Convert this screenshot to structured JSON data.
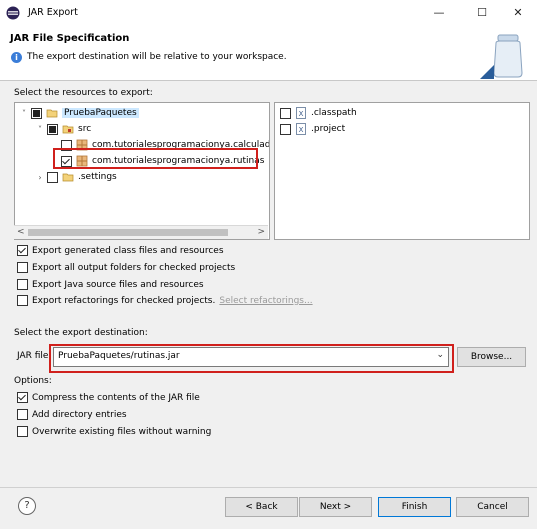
{
  "window": {
    "title": "JAR Export",
    "minimize": "—",
    "maximize": "☐",
    "close": "✕"
  },
  "header": {
    "title": "JAR File Specification",
    "message": "The export destination will be relative to your workspace."
  },
  "resources_label": "Select the resources to export:",
  "tree": {
    "project": "PruebaPaquetes",
    "src": "src",
    "pkg1": "com.tutorialesprogramacionya.calculadora",
    "pkg2": "com.tutorialesprogramacionya.rutinas",
    "settings": ".settings"
  },
  "files": [
    {
      "name": ".classpath",
      "checked": false
    },
    {
      "name": ".project",
      "checked": false
    }
  ],
  "options1": {
    "export_class": "Export generated class files and resources",
    "export_output": "Export all output folders for checked projects",
    "export_source": "Export Java source files and resources",
    "export_refactor": "Export refactorings for checked projects.",
    "select_refactorings": "Select refactorings..."
  },
  "destination": {
    "label": "Select the export destination:",
    "jar_label": "JAR file:",
    "jar_value": "PruebaPaquetes/rutinas.jar",
    "browse": "Browse..."
  },
  "options2": {
    "label": "Options:",
    "compress": "Compress the contents of the JAR file",
    "dir_entries": "Add directory entries",
    "overwrite": "Overwrite existing files without warning"
  },
  "buttons": {
    "help": "?",
    "back": "< Back",
    "next": "Next >",
    "finish": "Finish",
    "cancel": "Cancel"
  },
  "colors": {
    "highlight": "#d0201c",
    "info_icon": "#3b7dd8"
  }
}
